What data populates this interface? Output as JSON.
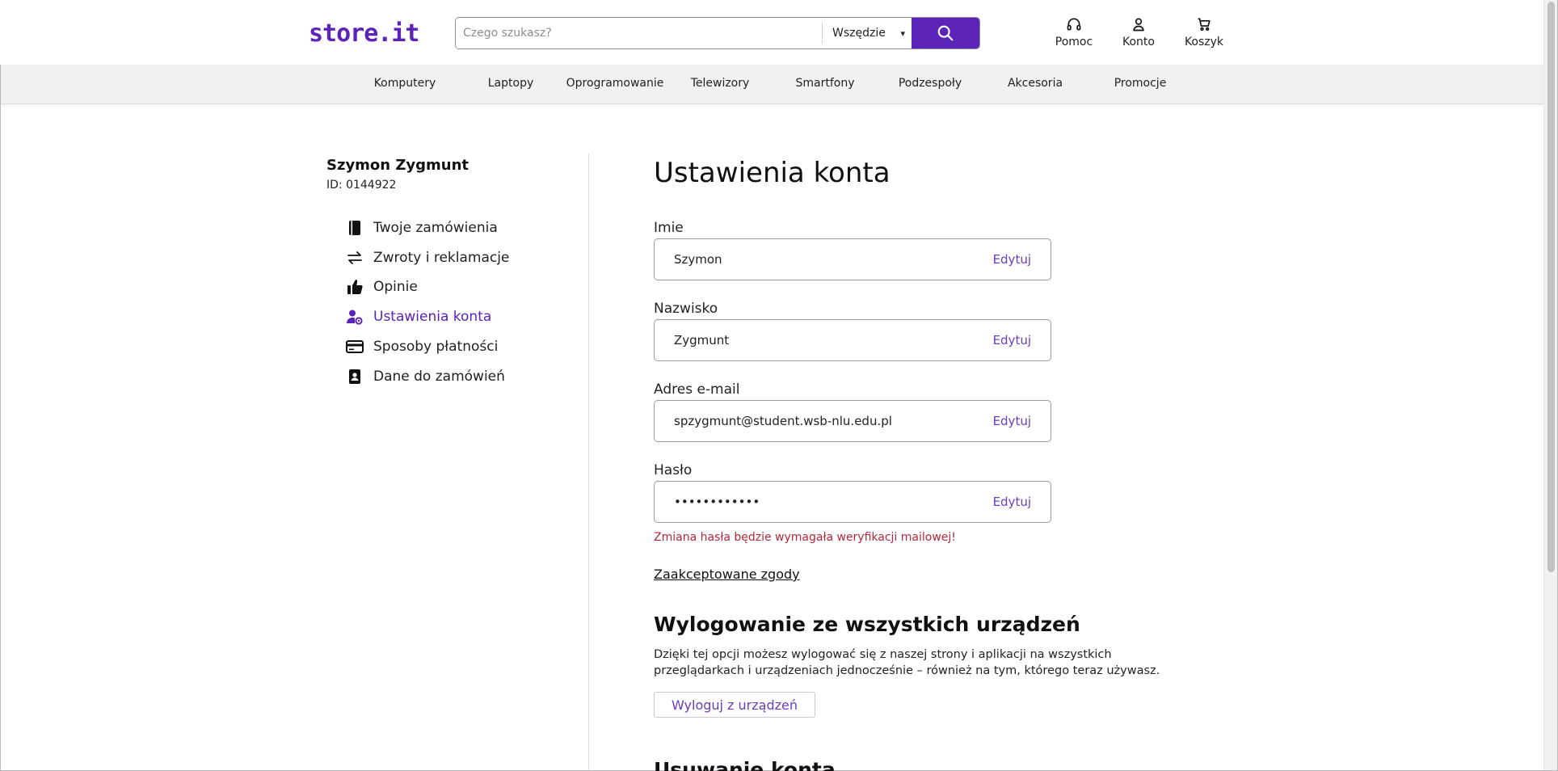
{
  "header": {
    "logo": "store.it",
    "search": {
      "placeholder": "Czego szukasz?",
      "scope": "Wszędzie"
    },
    "actions": [
      {
        "label": "Pomoc",
        "icon": "headphones-icon"
      },
      {
        "label": "Konto",
        "icon": "user-icon"
      },
      {
        "label": "Koszyk",
        "icon": "cart-icon"
      }
    ]
  },
  "nav": [
    "Komputery",
    "Laptopy",
    "Oprogramowanie",
    "Telewizory",
    "Smartfony",
    "Podzespoły",
    "Akcesoria",
    "Promocje"
  ],
  "sidebar": {
    "user_name": "Szymon Zygmunt",
    "user_id": "ID: 0144922",
    "items": [
      {
        "label": "Twoje zamówienia",
        "icon": "book-icon"
      },
      {
        "label": "Zwroty i reklamacje",
        "icon": "exchange-icon"
      },
      {
        "label": "Opinie",
        "icon": "thumbs-up-icon"
      },
      {
        "label": "Ustawienia konta",
        "icon": "user-gear-icon",
        "active": true
      },
      {
        "label": "Sposoby płatności",
        "icon": "credit-card-icon"
      },
      {
        "label": "Dane do zamówień",
        "icon": "contact-book-icon"
      }
    ]
  },
  "main": {
    "title": "Ustawienia konta",
    "fields": [
      {
        "label": "Imie",
        "value": "Szymon",
        "action": "Edytuj"
      },
      {
        "label": "Nazwisko",
        "value": "Zygmunt",
        "action": "Edytuj"
      },
      {
        "label": "Adres e-mail",
        "value": "spzygmunt@student.wsb-nlu.edu.pl",
        "action": "Edytuj"
      },
      {
        "label": "Hasło",
        "value": "••••••••••••",
        "action": "Edytuj"
      }
    ],
    "password_warning": "Zmiana hasła będzie wymagała weryfikacji mailowej!",
    "consents_link": "Zaakceptowane zgody",
    "logout_section": {
      "title": "Wylogowanie ze wszystkich urządzeń",
      "description": "Dzięki tej opcji możesz wylogować się z naszej strony i aplikacji na wszystkich przeglądarkach i urządzeniach jednocześnie – również na tym, którego teraz używasz.",
      "button": "Wyloguj z urządzeń"
    },
    "delete_section": {
      "title": "Usuwanie konta"
    }
  },
  "colors": {
    "accent": "#5b23b8",
    "link": "#6b3cbe",
    "warning": "#b3283b",
    "nav_bg": "#f1f1f3"
  }
}
